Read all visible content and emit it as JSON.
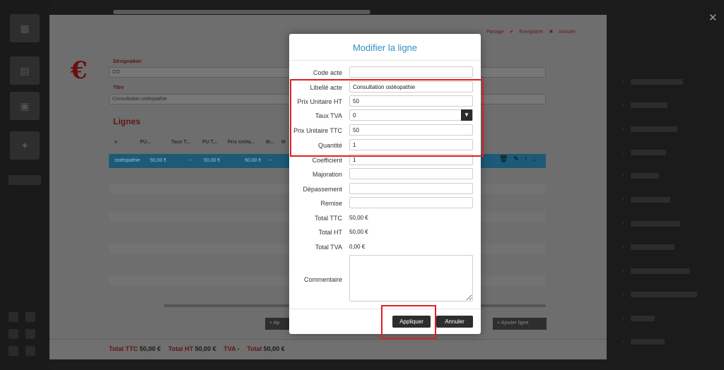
{
  "background": {
    "header_actions": [
      "Partage",
      "✔",
      "Enregistrer",
      "✖",
      "Annuler"
    ],
    "designation": {
      "label": "Désignation",
      "value": "CO"
    },
    "titre": {
      "label": "Titre",
      "value": "Consultation ostéopathie"
    },
    "lignes_title": "Lignes",
    "table_headers": [
      "e",
      "PU...",
      "Taux T...",
      "PU T...",
      "Prix Unita...",
      "M...",
      "M"
    ],
    "selected_row": {
      "cells": [
        "ostéopathie",
        "50,00 €",
        "--",
        "50,00 €",
        "50,00 €",
        "--"
      ]
    },
    "buttons": {
      "add_left": "+  Ap",
      "add_right": "+  Ajouter ligne"
    },
    "totals": [
      {
        "label": "Total TTC",
        "value": "50,00 €"
      },
      {
        "label": "Total HT",
        "value": "50,00 €"
      },
      {
        "label": "TVA",
        "value": "-"
      },
      {
        "label": "Total",
        "value": "50,00 €"
      }
    ]
  },
  "modal": {
    "title": "Modifier la ligne",
    "fields": {
      "code_acte": {
        "label": "Code acte",
        "value": ""
      },
      "libelle_acte": {
        "label": "Libellé acte",
        "value": "Consultation ostéopathie"
      },
      "prix_unitaire_ht": {
        "label": "Prix Unitaire HT",
        "value": "50"
      },
      "taux_tva": {
        "label": "Taux TVA",
        "value": "0"
      },
      "prix_unitaire_ttc": {
        "label": "Prix Unitaire TTC",
        "value": "50"
      },
      "quantite": {
        "label": "Quantité",
        "value": "1"
      },
      "coefficient": {
        "label": "Coefficient",
        "value": "1"
      },
      "majoration": {
        "label": "Majoration",
        "value": ""
      },
      "depassement": {
        "label": "Dépassement",
        "value": ""
      },
      "remise": {
        "label": "Remise",
        "value": ""
      },
      "commentaire": {
        "label": "Commentaire",
        "value": ""
      }
    },
    "readonly": {
      "total_ttc": {
        "label": "Total TTC",
        "value": "50,00 €"
      },
      "total_ht": {
        "label": "Total HT",
        "value": "50,00 €"
      },
      "total_tva": {
        "label": "Total TVA",
        "value": "0,00 €"
      }
    },
    "buttons": {
      "apply": "Appliquer",
      "cancel": "Annuler"
    }
  },
  "close_glyph": "✕",
  "colors": {
    "accent": "#2f8ec4",
    "annotation": "#e02020",
    "brand_red": "#8b1a1a"
  }
}
